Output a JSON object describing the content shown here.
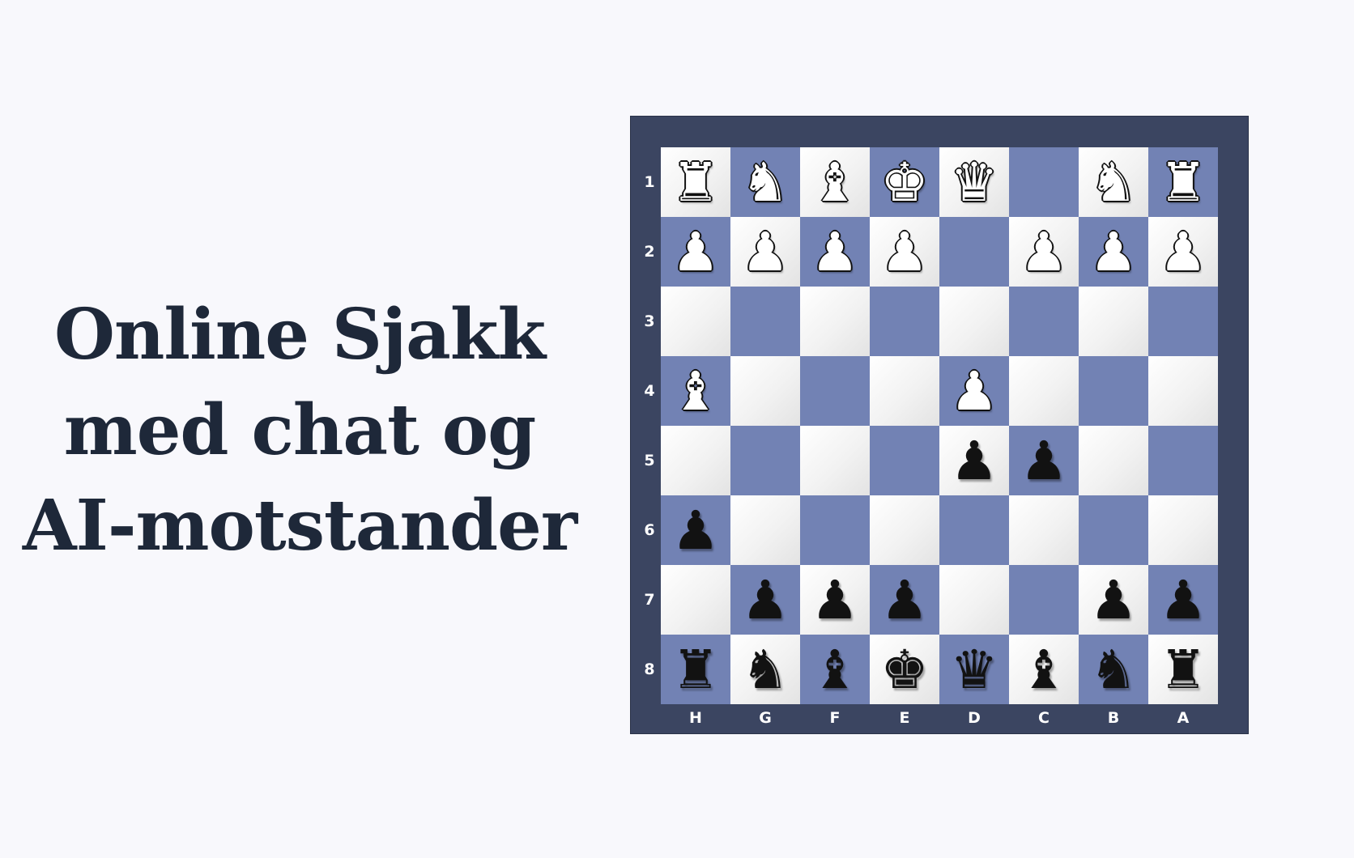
{
  "headline": {
    "line1": "Online Sjakk",
    "line2": "med chat og",
    "line3": "AI-motstander"
  },
  "board": {
    "colors": {
      "frame": "#3b4561",
      "dark_square": "#7282b4",
      "light_square": "#f2f2f2",
      "label": "#ffffff"
    },
    "rank_labels": [
      "1",
      "2",
      "3",
      "4",
      "5",
      "6",
      "7",
      "8"
    ],
    "file_labels": [
      "H",
      "G",
      "F",
      "E",
      "D",
      "C",
      "B",
      "A"
    ],
    "rows": [
      [
        "wR",
        "wN",
        "wB",
        "wK",
        "wQ",
        "",
        "wN",
        "wR"
      ],
      [
        "wP",
        "wP",
        "wP",
        "wP",
        "",
        "wP",
        "wP",
        "wP"
      ],
      [
        "",
        "",
        "",
        "",
        "",
        "",
        "",
        ""
      ],
      [
        "wB",
        "",
        "",
        "",
        "wP",
        "",
        "",
        ""
      ],
      [
        "",
        "",
        "",
        "",
        "bP",
        "bP",
        "",
        ""
      ],
      [
        "bP",
        "",
        "",
        "",
        "",
        "",
        "",
        ""
      ],
      [
        "",
        "bP",
        "bP",
        "bP",
        "",
        "",
        "bP",
        "bP"
      ],
      [
        "bR",
        "bN",
        "bB",
        "bK",
        "bQ",
        "bB",
        "bN",
        "bR"
      ]
    ]
  }
}
